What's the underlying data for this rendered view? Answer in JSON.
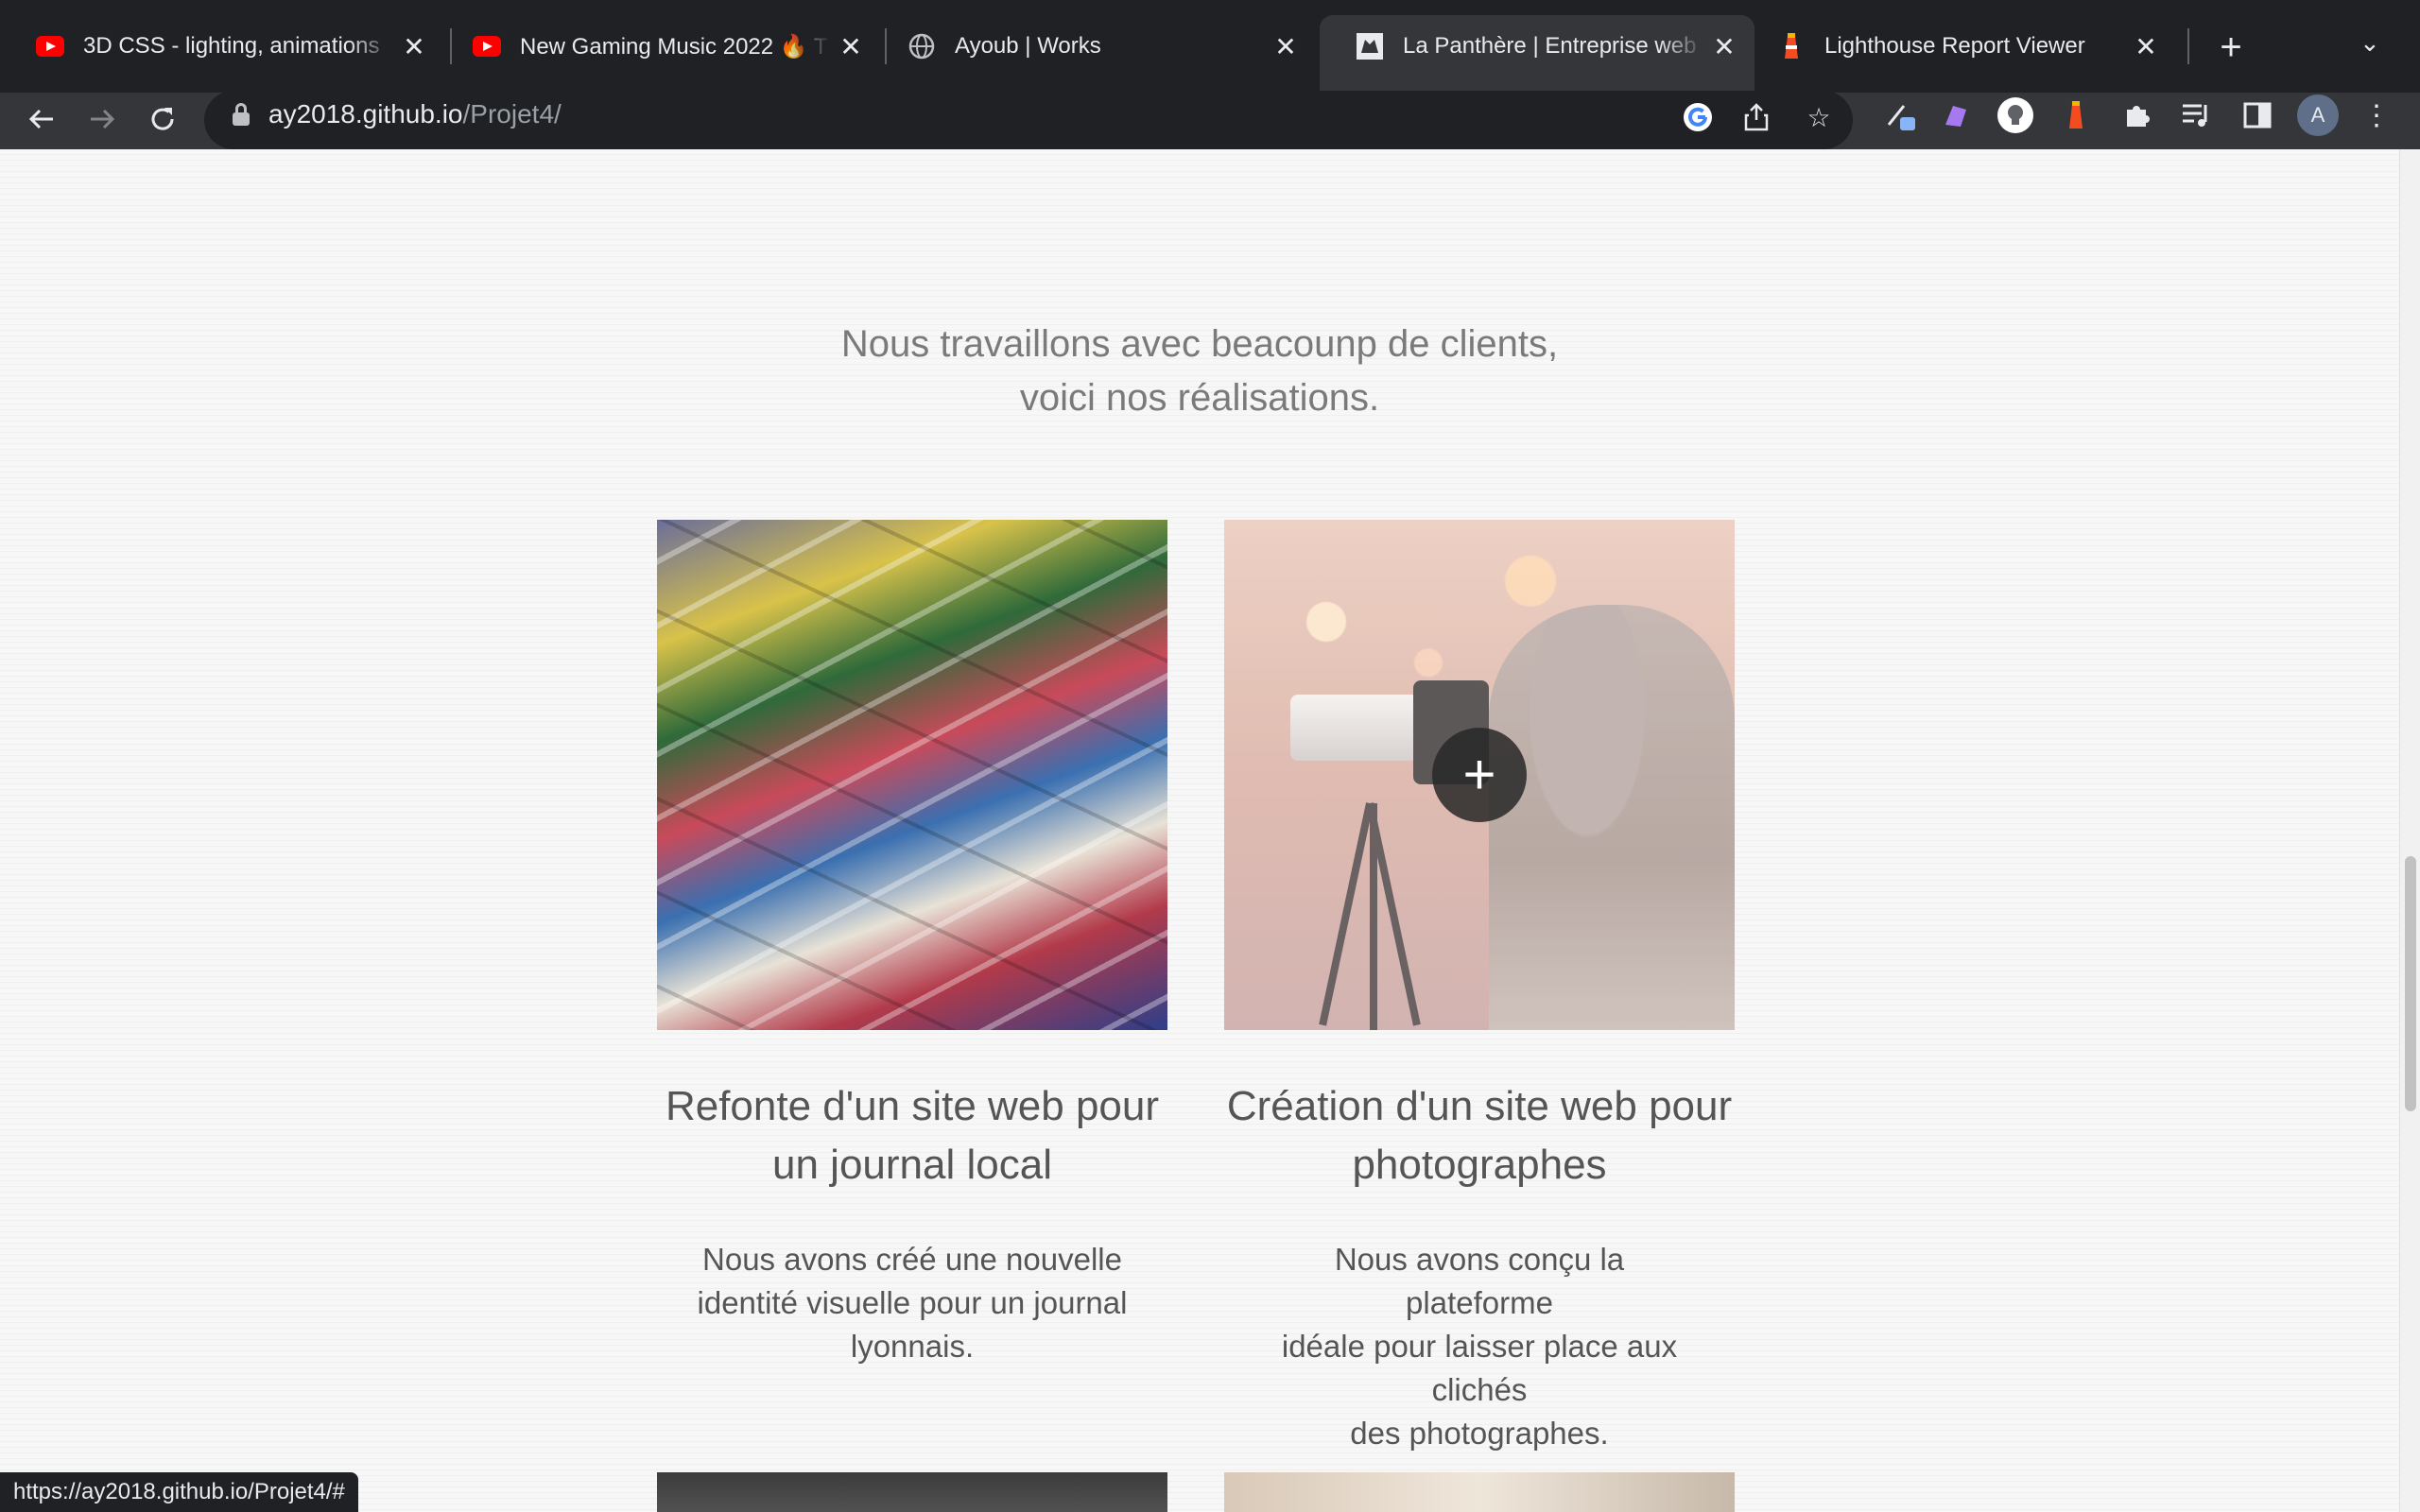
{
  "browser": {
    "tabs": [
      {
        "title": "3D CSS - lighting, animations",
        "icon": "youtube-icon"
      },
      {
        "title": "New Gaming Music 2022 🔥 T",
        "icon": "youtube-icon"
      },
      {
        "title": "Ayoub | Works",
        "icon": "globe-icon"
      },
      {
        "title": "La Panthère | Entreprise web",
        "icon": "panther-icon"
      },
      {
        "title": "Lighthouse Report Viewer",
        "icon": "lighthouse-icon"
      }
    ],
    "address": {
      "host": "ay2018.github.io",
      "path": "/Projet4/"
    },
    "profile_initial": "A",
    "status_url": "https://ay2018.github.io/Projet4/#"
  },
  "page": {
    "intro_line1": "Nous travaillons avec beacounp de clients,",
    "intro_line2": "voici nos réalisations.",
    "projects": [
      {
        "title_line1": "Refonte d'un site web pour",
        "title_line2": "un journal local",
        "desc_line1": "Nous avons créé une nouvelle",
        "desc_line2": "identité visuelle pour un journal",
        "desc_line3": "lyonnais."
      },
      {
        "title_line1": "Création d'un site web pour",
        "title_line2": "photographes",
        "desc_line1": "Nous avons conçu la plateforme",
        "desc_line2": "idéale pour laisser place aux clichés",
        "desc_line3": "des photographes.",
        "hover_symbol": "+"
      }
    ]
  }
}
